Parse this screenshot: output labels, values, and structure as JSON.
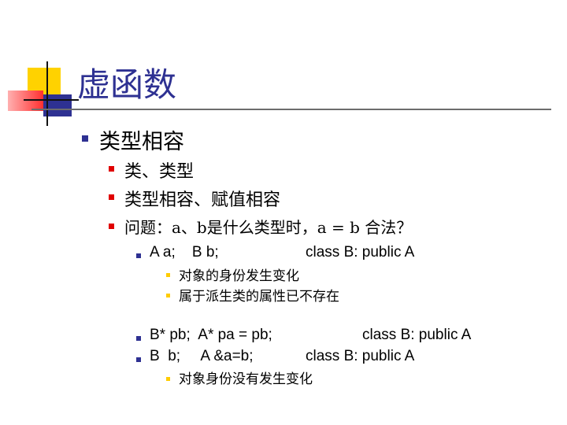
{
  "slide": {
    "title": "虚函数",
    "items": [
      {
        "text": "类型相容"
      },
      {
        "text": "类、类型"
      },
      {
        "text": "类型相容、赋值相容"
      },
      {
        "text": "问题：a、b是什么类型时，a = b 合法？"
      },
      {
        "code": "A a;    B b;",
        "note": "class B: public A"
      },
      {
        "text": "对象的身份发生变化"
      },
      {
        "text": "属于派生类的属性已不存在"
      },
      {
        "code": "B* pb;  A* pa = pb;",
        "note": "class B: public A"
      },
      {
        "code": "B  b;     A &a=b;",
        "note": "class B: public A"
      },
      {
        "text": "对象身份没有发生变化"
      }
    ]
  },
  "colors": {
    "title": "#2e3192",
    "bullet_level1": "#2e3192",
    "bullet_level2": "#e00000",
    "bullet_level3": "#2e3192",
    "bullet_level4": "#ffcc00",
    "deco_yellow": "#ffd200",
    "deco_red": "#ff3030",
    "deco_blue": "#2e3192"
  }
}
